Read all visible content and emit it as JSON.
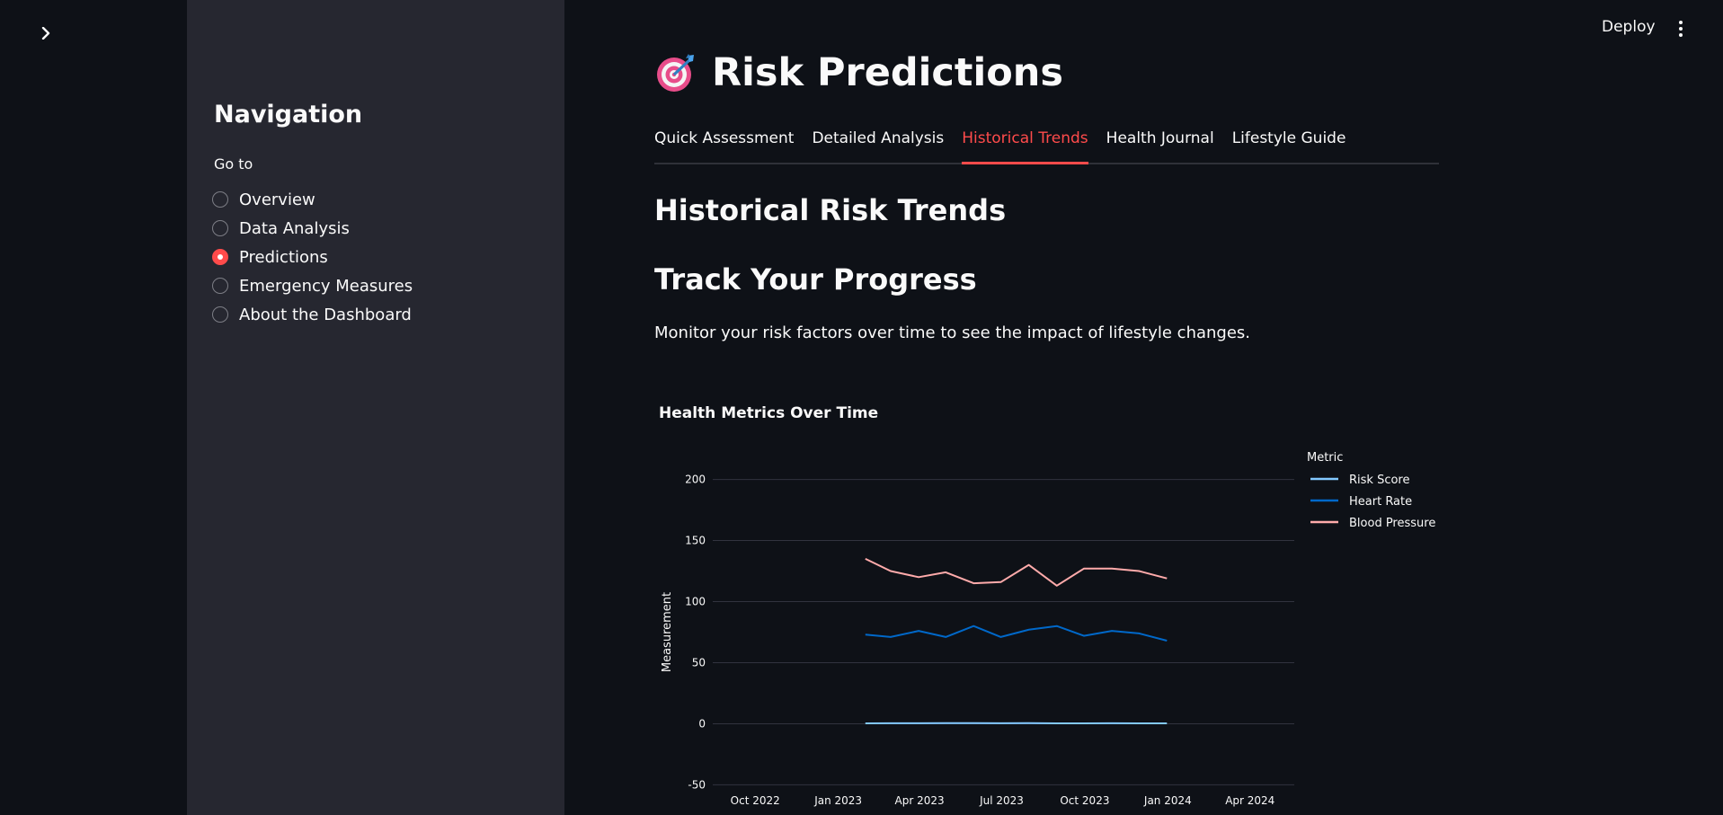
{
  "app": {
    "deploy_label": "Deploy"
  },
  "sidebar": {
    "title": "Navigation",
    "radio_label": "Go to",
    "items": [
      {
        "label": "Overview",
        "selected": false
      },
      {
        "label": "Data Analysis",
        "selected": false
      },
      {
        "label": "Predictions",
        "selected": true
      },
      {
        "label": "Emergency Measures",
        "selected": false
      },
      {
        "label": "About the Dashboard",
        "selected": false
      }
    ]
  },
  "header": {
    "title": "Risk Predictions",
    "icon": "target-dart-icon"
  },
  "tabs": [
    {
      "label": "Quick Assessment",
      "active": false
    },
    {
      "label": "Detailed Analysis",
      "active": false
    },
    {
      "label": "Historical Trends",
      "active": true
    },
    {
      "label": "Health Journal",
      "active": false
    },
    {
      "label": "Lifestyle Guide",
      "active": false
    }
  ],
  "content": {
    "heading": "Historical Risk Trends",
    "subheading": "Track Your Progress",
    "description": "Monitor your risk factors over time to see the impact of lifestyle changes."
  },
  "colors": {
    "accent": "#ff4b4b",
    "risk_score": "#83c9ff",
    "heart_rate": "#0068c9",
    "blood_pressure": "#ffabab"
  },
  "chart_data": {
    "type": "line",
    "title": "Health Metrics Over Time",
    "xlabel": "",
    "ylabel": "Measurement",
    "legend_title": "Metric",
    "legend_position": "right",
    "grid": true,
    "ylim": [
      -60,
      210
    ],
    "xlim": [
      "2022-08-15",
      "2024-05-20"
    ],
    "y_ticks": [
      200,
      150,
      100,
      50,
      0,
      -50
    ],
    "x_ticks": [
      {
        "date": "2022-10-01",
        "label": "Oct 2022"
      },
      {
        "date": "2023-01-01",
        "label": "Jan 2023"
      },
      {
        "date": "2023-04-01",
        "label": "Apr 2023"
      },
      {
        "date": "2023-07-01",
        "label": "Jul 2023"
      },
      {
        "date": "2023-10-01",
        "label": "Oct 2023"
      },
      {
        "date": "2024-01-01",
        "label": "Jan 2024"
      },
      {
        "date": "2024-04-01",
        "label": "Apr 2024"
      }
    ],
    "x": [
      "2023-01-31",
      "2023-02-28",
      "2023-03-31",
      "2023-04-30",
      "2023-05-31",
      "2023-06-30",
      "2023-07-31",
      "2023-08-31",
      "2023-09-30",
      "2023-10-31",
      "2023-11-30",
      "2023-12-31"
    ],
    "series": [
      {
        "name": "Risk Score",
        "color": "#83c9ff",
        "values": [
          0.3,
          0.4,
          0.4,
          0.5,
          0.5,
          0.4,
          0.5,
          0.3,
          0.3,
          0.4,
          0.3,
          0.3
        ]
      },
      {
        "name": "Heart Rate",
        "color": "#0068c9",
        "values": [
          73,
          71,
          76,
          71,
          80,
          71,
          77,
          80,
          72,
          76,
          74,
          68
        ]
      },
      {
        "name": "Blood Pressure",
        "color": "#ffabab",
        "values": [
          135,
          125,
          120,
          124,
          115,
          116,
          130,
          113,
          127,
          127,
          125,
          119
        ]
      }
    ]
  }
}
